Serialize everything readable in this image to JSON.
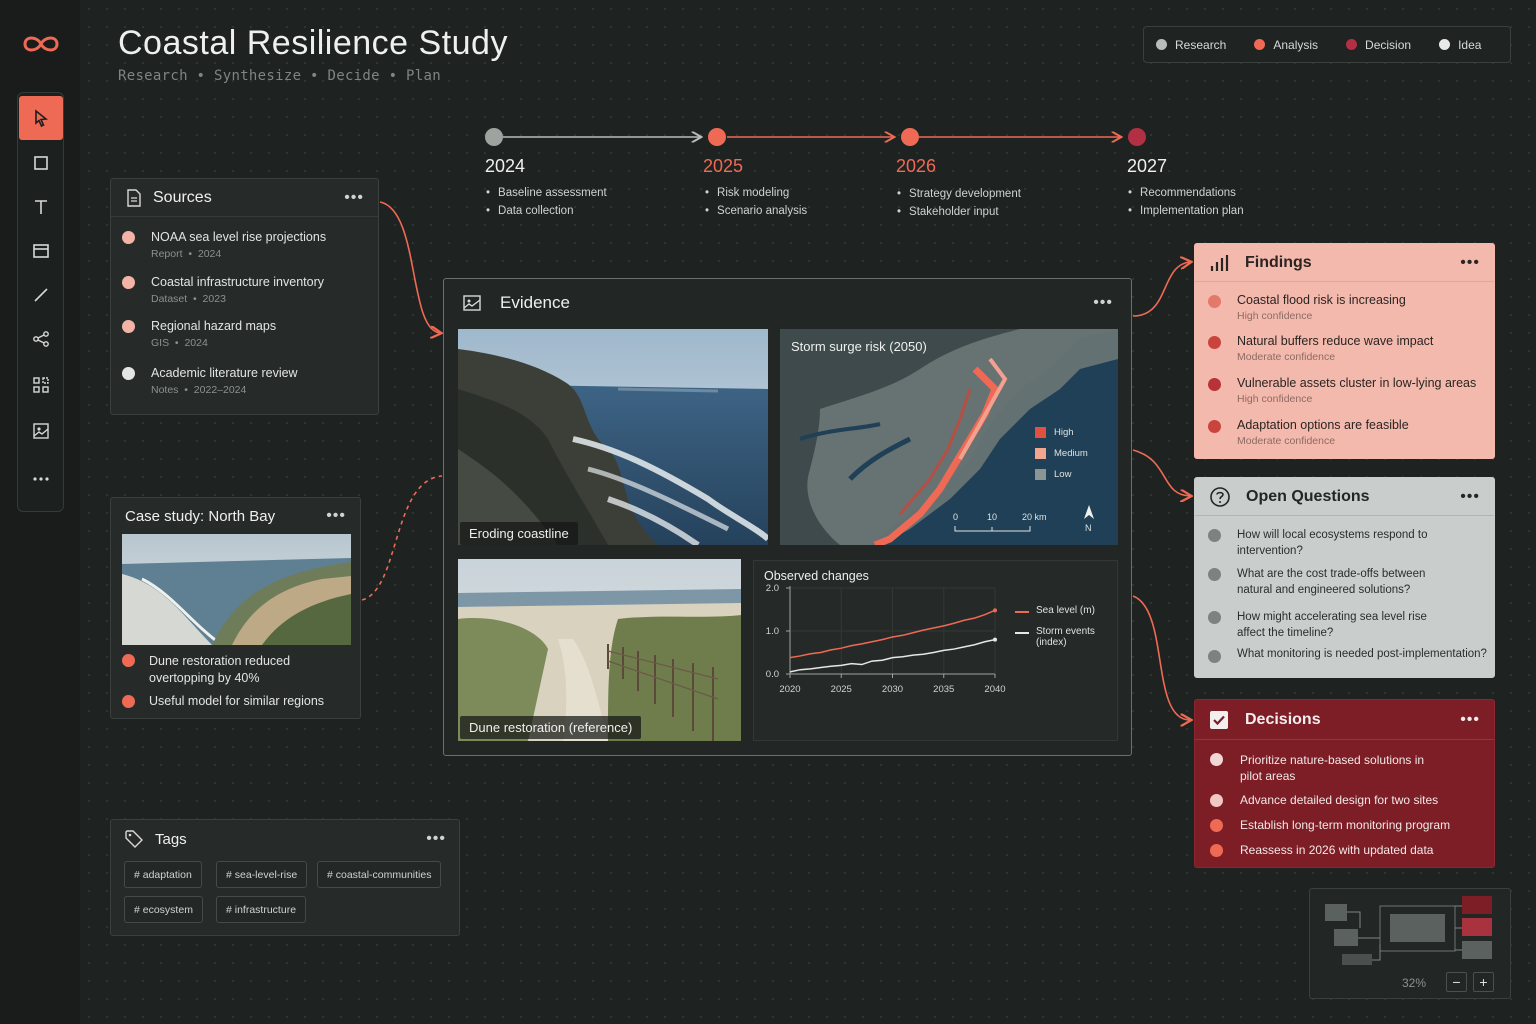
{
  "app": {
    "title": "Coastal Resilience Study",
    "subtitle": "Research  •  Synthesize  •  Decide  •  Plan"
  },
  "toolbar": {
    "tools": [
      "cursor-tool",
      "rectangle-tool",
      "text-tool",
      "frame-tool",
      "line-tool",
      "connector-tool",
      "components-tool",
      "image-tool",
      "more-tool"
    ]
  },
  "legend": [
    {
      "label": "Research",
      "color": "#b8bcba"
    },
    {
      "label": "Analysis",
      "color": "#ee6a55"
    },
    {
      "label": "Decision",
      "color": "#b23043"
    },
    {
      "label": "Idea",
      "color": "#e8eae9"
    }
  ],
  "timeline": [
    {
      "year": "2024",
      "items": [
        "Baseline assessment",
        "Data collection"
      ]
    },
    {
      "year": "2025",
      "items": [
        "Risk modeling",
        "Scenario analysis"
      ]
    },
    {
      "year": "2026",
      "items": [
        "Strategy development",
        "Stakeholder input"
      ]
    },
    {
      "year": "2027",
      "items": [
        "Recommendations",
        "Implementation plan"
      ]
    }
  ],
  "sources": {
    "title": "Sources",
    "items": [
      {
        "title": "NOAA sea level rise projections",
        "type": "Report",
        "year": "2024"
      },
      {
        "title": "Coastal infrastructure inventory",
        "type": "Dataset",
        "year": "2023"
      },
      {
        "title": "Regional hazard maps",
        "type": "GIS",
        "year": "2024"
      },
      {
        "title": "Academic literature review",
        "type": "Notes",
        "year": "2022–2024"
      }
    ]
  },
  "case_study": {
    "title": "Case study: North Bay",
    "items": [
      "Dune restoration reduced overtopping by 40%",
      "Useful model for similar regions"
    ]
  },
  "tags": {
    "title": "Tags",
    "items": [
      "# adaptation",
      "# sea-level-rise",
      "# coastal-communities",
      "# ecosystem",
      "# infrastructure"
    ]
  },
  "evidence": {
    "title": "Evidence",
    "photo1_caption": "Eroding coastline",
    "photo2_caption": "Dune restoration (reference)",
    "map": {
      "title": "Storm surge risk (2050)",
      "legend": [
        "High",
        "Medium",
        "Low"
      ],
      "scale": [
        "0",
        "10",
        "20 km"
      ],
      "north": "N"
    }
  },
  "findings": {
    "title": "Findings",
    "items": [
      {
        "text": "Coastal flood risk is increasing",
        "conf": "High confidence"
      },
      {
        "text": "Natural buffers reduce wave impact",
        "conf": "Moderate confidence"
      },
      {
        "text": "Vulnerable assets cluster in low-lying areas",
        "conf": "High confidence"
      },
      {
        "text": "Adaptation options are feasible",
        "conf": "Moderate confidence"
      }
    ]
  },
  "questions": {
    "title": "Open Questions",
    "items": [
      "How will local ecosystems respond to intervention?",
      "What are the cost trade-offs between natural and engineered solutions?",
      "How might accelerating sea level rise affect the timeline?",
      "What monitoring is needed post-implementation?"
    ]
  },
  "decisions": {
    "title": "Decisions",
    "items": [
      "Prioritize nature-based solutions in pilot areas",
      "Advance detailed design for two sites",
      "Establish long-term monitoring program",
      "Reassess in 2026 with updated data"
    ]
  },
  "minimap": {
    "zoom": "32%",
    "minus": "−",
    "plus": "+"
  },
  "chart_data": {
    "type": "line",
    "title": "Observed changes",
    "x": [
      2020,
      2021,
      2022,
      2023,
      2024,
      2025,
      2026,
      2027,
      2028,
      2029,
      2030,
      2031,
      2032,
      2033,
      2034,
      2035,
      2036,
      2037,
      2038,
      2039,
      2040
    ],
    "series": [
      {
        "name": "Sea level (m)",
        "color": "#ee6a55",
        "values": [
          0.38,
          0.42,
          0.47,
          0.5,
          0.56,
          0.6,
          0.66,
          0.7,
          0.75,
          0.8,
          0.86,
          0.9,
          0.96,
          1.02,
          1.07,
          1.12,
          1.18,
          1.25,
          1.3,
          1.38,
          1.48
        ]
      },
      {
        "name": "Storm events (index)",
        "color": "#e6e8e6",
        "values": [
          0.05,
          0.1,
          0.12,
          0.15,
          0.18,
          0.2,
          0.24,
          0.22,
          0.3,
          0.32,
          0.38,
          0.4,
          0.44,
          0.46,
          0.5,
          0.55,
          0.58,
          0.63,
          0.68,
          0.75,
          0.8
        ]
      }
    ],
    "xticks": [
      "2020",
      "2025",
      "2030",
      "2035",
      "2040"
    ],
    "yticks": [
      "0.0",
      "1.0",
      "2.0"
    ],
    "ylim": [
      0,
      2
    ]
  }
}
